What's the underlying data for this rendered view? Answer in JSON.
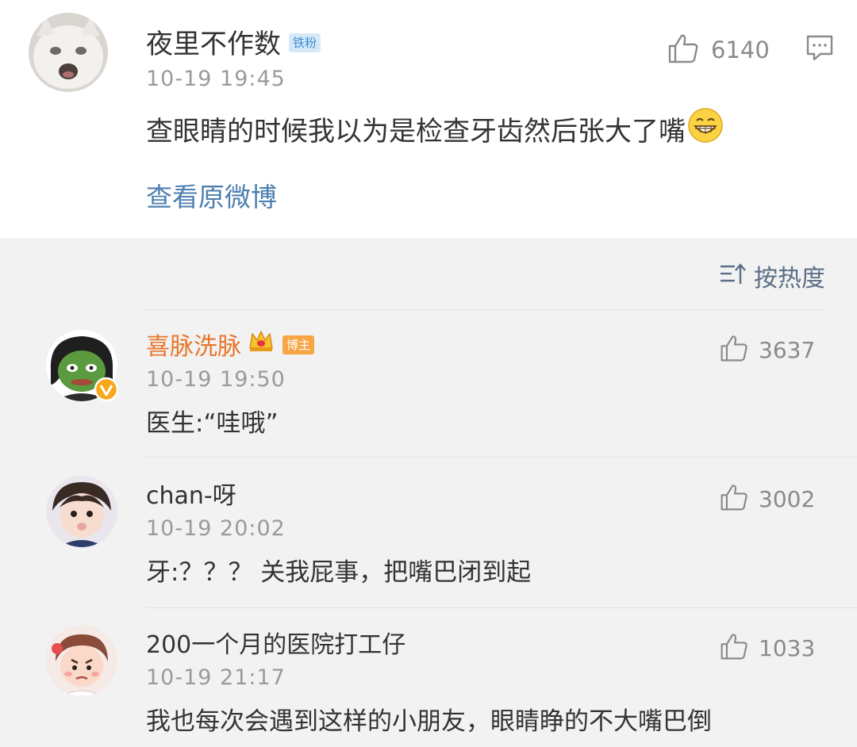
{
  "post": {
    "username": "夜里不作数",
    "badge": "铁粉",
    "time": "10-19 19:45",
    "text": "查眼睛的时候我以为是检查牙齿然后张大了嘴",
    "view_original": "查看原微博",
    "likes": "6140"
  },
  "sort": {
    "label": "按热度"
  },
  "comments": [
    {
      "username": "喜脉洗脉",
      "badge": "博主",
      "time": "10-19 19:50",
      "text": "医生:“哇哦”",
      "likes": "3637"
    },
    {
      "username": "chan-呀",
      "time": "10-19 20:02",
      "text": "牙:？？？ 关我屁事，把嘴巴闭到起",
      "likes": "3002"
    },
    {
      "username": "200一个月的医院打工仔",
      "time": "10-19 21:17",
      "text": "我也每次会遇到这样的小朋友，眼睛睁的不大嘴巴倒",
      "likes": "1033"
    }
  ],
  "colors": {
    "link_blue": "#4d7fb0",
    "vip_orange": "#e8762c",
    "badge_orange": "#f7a545",
    "fan_badge_bg": "#d7e9f7"
  },
  "icons": [
    "thumbs-up-icon",
    "comment-icon",
    "sort-icon",
    "crown-icon",
    "grin-emoji-icon",
    "verified-v-icon"
  ]
}
